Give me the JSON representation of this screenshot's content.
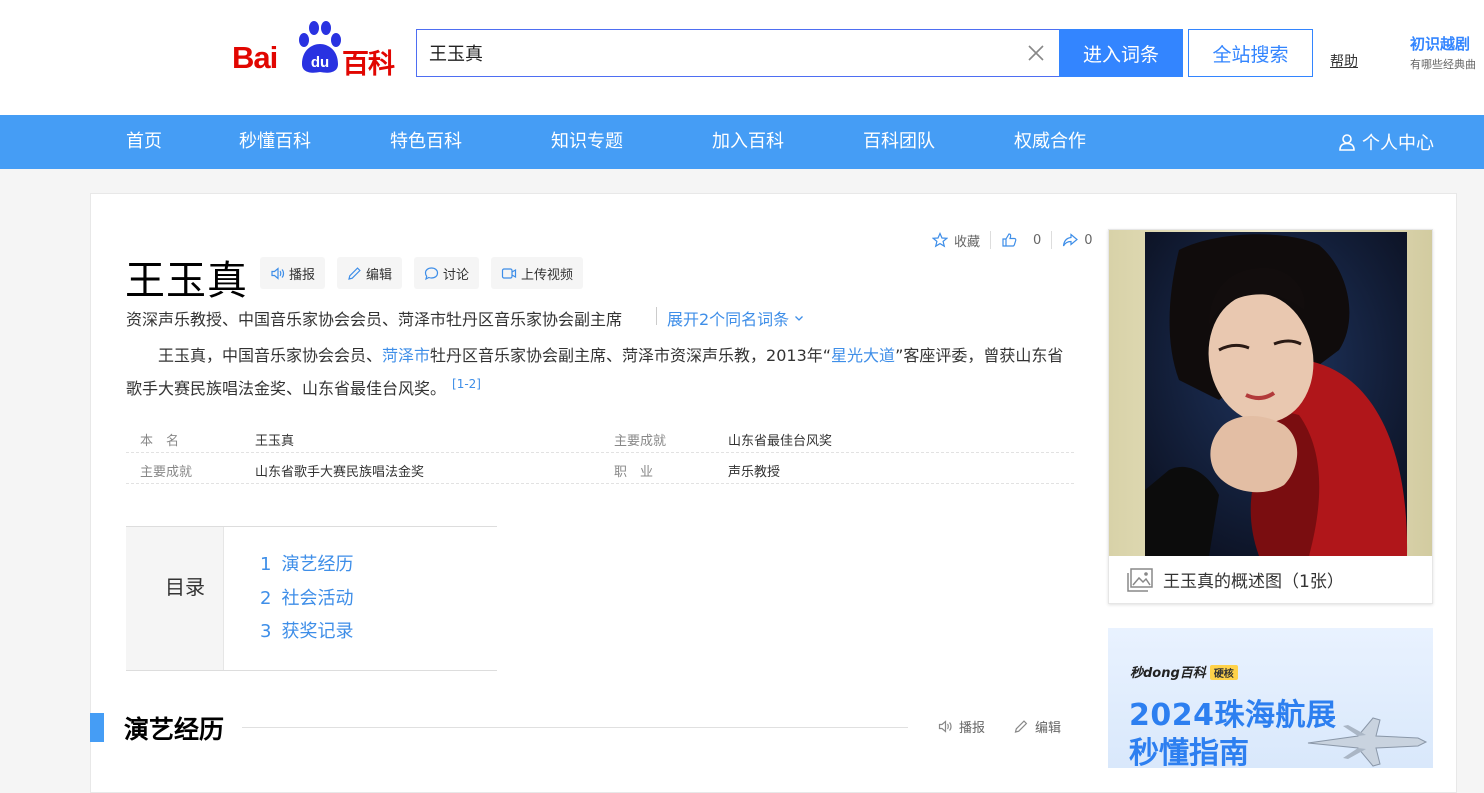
{
  "header": {
    "logo_bai": "Bai",
    "logo_du": "du",
    "logo_baike": "百科",
    "search_value": "王玉真",
    "enter_label": "进入词条",
    "site_search_label": "全站搜索",
    "help_label": "帮助",
    "promo_title": "初识越剧",
    "promo_sub": "有哪些经典曲"
  },
  "nav": {
    "items": [
      "首页",
      "秒懂百科",
      "特色百科",
      "知识专题",
      "加入百科",
      "百科团队",
      "权威合作"
    ],
    "user_center": "个人中心"
  },
  "entry": {
    "title": "王玉真",
    "actions": [
      "播报",
      "编辑",
      "讨论",
      "上传视频"
    ],
    "top_tools": {
      "collect": "收藏",
      "like_count": "0",
      "share_count": "0"
    },
    "subtitle": "资深声乐教授、中国音乐家协会会员、菏泽市牡丹区音乐家协会副主席",
    "expand_label": "展开2个同名词条",
    "summary": {
      "p1": "王玉真，中国音乐家协会会员、",
      "link1": "菏泽市",
      "p2": "牡丹区音乐家协会副主席、菏泽市资深声乐教，2013年“",
      "link2": "星光大道",
      "p3": "”客座评委，曾获山东省歌手大赛民族唱法金奖、山东省最佳台风奖。",
      "ref": "[1-2]"
    },
    "basic_info": [
      {
        "k1": "本　名",
        "v1": "王玉真",
        "k2": "主要成就",
        "v2": "山东省最佳台风奖"
      },
      {
        "k1": "主要成就",
        "v1": "山东省歌手大赛民族唱法金奖",
        "k2": "职　业",
        "v2": "声乐教授"
      }
    ],
    "toc": {
      "label": "目录",
      "items": [
        {
          "num": "1",
          "label": "演艺经历"
        },
        {
          "num": "2",
          "label": "社会活动"
        },
        {
          "num": "3",
          "label": "获奖记录"
        }
      ]
    },
    "section": {
      "title": "演艺经历",
      "tool_play": "播报",
      "tool_edit": "编辑"
    }
  },
  "sidebar": {
    "photo_caption": "王玉真的概述图（1张）",
    "ad_brand": "秒dong百科",
    "ad_tag": "硬核",
    "ad_line1": "2024珠海航展",
    "ad_line2": "秒懂指南"
  },
  "colors": {
    "brand_red": "#e10601",
    "nav_blue": "#459df5",
    "button_blue": "#3385ff",
    "link_blue": "#3e8ee8"
  }
}
